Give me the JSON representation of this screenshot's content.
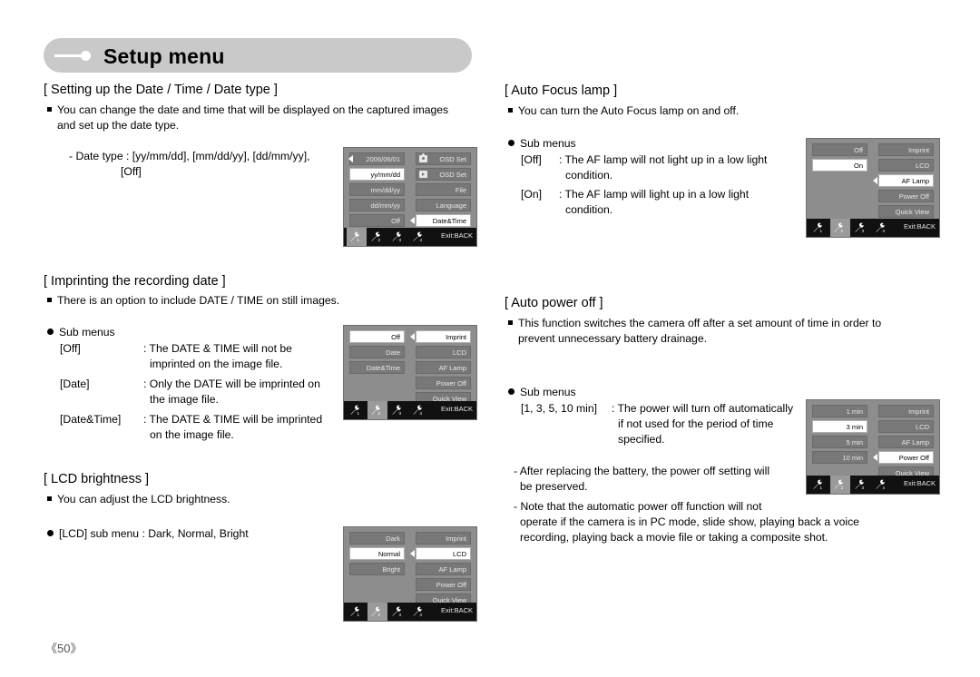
{
  "header": {
    "title": "Setup menu"
  },
  "page_number": "《50》",
  "sections": {
    "date_time": {
      "title": "[ Setting up the Date / Time / Date type ]",
      "bullet1_line1": "You can change the date and time that will be displayed on the captured images",
      "bullet1_line2": "and set up the date type.",
      "detail_line1": "- Date type : [yy/mm/dd], [mm/dd/yy], [dd/mm/yy],",
      "detail_line2": "[Off]"
    },
    "imprint": {
      "title": "[ Imprinting the recording date ]",
      "bullet1": "There is an option to include DATE / TIME on still images.",
      "submenus_label": "Sub menus",
      "rows": [
        {
          "key": "[Off]",
          "line1": ": The DATE & TIME will not be",
          "line2": "imprinted on the image file."
        },
        {
          "key": "[Date]",
          "line1": ": Only the DATE will be imprinted on",
          "line2": "the image file."
        },
        {
          "key": "[Date&Time]",
          "line1": ": The DATE & TIME will be imprinted",
          "line2": "on the image file."
        }
      ]
    },
    "lcd_brightness": {
      "title": "[ LCD brightness ]",
      "bullet1": "You can adjust the LCD brightness.",
      "bullet2": "[LCD] sub menu : Dark, Normal, Bright"
    },
    "af_lamp": {
      "title": "[ Auto Focus lamp ]",
      "bullet1": "You can turn the Auto Focus lamp on and off.",
      "submenus_label": "Sub menus",
      "rows": [
        {
          "key": "[Off]",
          "line1": ": The AF lamp will not light up in a low light",
          "line2": "condition."
        },
        {
          "key": "[On]",
          "line1": ": The AF lamp will light up in a low light",
          "line2": "condition."
        }
      ]
    },
    "auto_power_off": {
      "title": "[ Auto power off ]",
      "bullet1_line1": "This function switches the camera off after a set amount of time in order to",
      "bullet1_line2": "prevent unnecessary battery drainage.",
      "submenus_label": "Sub menus",
      "row_key": "[1, 3, 5, 10 min]",
      "row_line1": ": The power will turn off automatically",
      "row_line2": "if not used for the period of time",
      "row_line3": "specified.",
      "note1_line1": "- After replacing the battery, the power off setting will",
      "note1_line2": "be preserved.",
      "note2_line1": "- Note that the automatic power off function will not",
      "note2_line2": "operate if the camera is in PC mode, slide show, playing back a voice",
      "note2_line3": "recording, playing back a movie file or taking a composite shot."
    }
  },
  "lcd_screens": {
    "date_time": {
      "left": [
        "2006/06/01",
        "yy/mm/dd",
        "mm/dd/yy",
        "dd/mm/yy",
        "Off"
      ],
      "left_selected": 1,
      "left_arrow_row": 0,
      "right": [
        "OSD Set",
        "OSD Set",
        "File",
        "Language",
        "Date&Time"
      ],
      "right_selected": 4,
      "right_arrow_row": 4,
      "right_icons": [
        "camera-icon",
        "playback-icon",
        "",
        "",
        ""
      ],
      "tabs": [
        "1",
        "2",
        "3",
        "4"
      ],
      "active_tab": 0,
      "exit": "Exit:BACK"
    },
    "af_lamp": {
      "left": [
        "Off",
        "On"
      ],
      "left_selected": 1,
      "right": [
        "Imprint",
        "LCD",
        "AF Lamp",
        "Power Off",
        "Quick View"
      ],
      "right_selected": 2,
      "right_arrow_row": 2,
      "tabs": [
        "1",
        "2",
        "3",
        "4"
      ],
      "active_tab": 1,
      "exit": "Exit:BACK"
    },
    "imprint": {
      "left": [
        "Off",
        "Date",
        "Date&Time"
      ],
      "left_selected": 0,
      "right": [
        "Imprint",
        "LCD",
        "AF Lamp",
        "Power Off",
        "Quick View"
      ],
      "right_selected": 0,
      "right_arrow_row": 0,
      "tabs": [
        "1",
        "2",
        "3",
        "4"
      ],
      "active_tab": 1,
      "exit": "Exit:BACK"
    },
    "power_off": {
      "left": [
        "1 min",
        "3 min",
        "5 min",
        "10 min"
      ],
      "left_selected": 1,
      "right": [
        "Imprint",
        "LCD",
        "AF Lamp",
        "Power Off",
        "Quick View"
      ],
      "right_selected": 3,
      "right_arrow_row": 3,
      "tabs": [
        "1",
        "2",
        "3",
        "4"
      ],
      "active_tab": 1,
      "exit": "Exit:BACK"
    },
    "lcd_bright": {
      "left": [
        "Dark",
        "Normal",
        "Bright"
      ],
      "left_selected": 1,
      "right": [
        "Imprint",
        "LCD",
        "AF Lamp",
        "Power Off",
        "Quick View"
      ],
      "right_selected": 1,
      "right_arrow_row": 1,
      "tabs": [
        "1",
        "2",
        "3",
        "4"
      ],
      "active_tab": 1,
      "exit": "Exit:BACK"
    }
  }
}
